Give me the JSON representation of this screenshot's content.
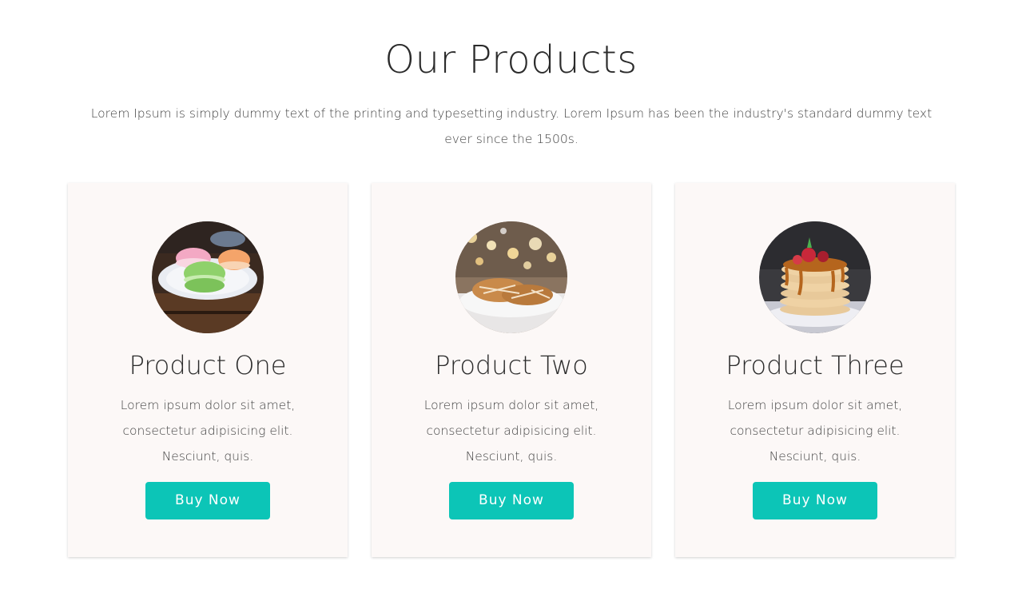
{
  "header": {
    "title": "Our Products",
    "description": "Lorem Ipsum is simply dummy text of the printing and typesetting industry. Lorem Ipsum has been the industry's standard dummy text ever since the 1500s."
  },
  "products": [
    {
      "name": "Product One",
      "description": "Lorem ipsum dolor sit amet, consectetur adipisicing elit. Nesciunt, quis.",
      "button_label": "Buy Now",
      "image": "macarons-photo"
    },
    {
      "name": "Product Two",
      "description": "Lorem ipsum dolor sit amet, consectetur adipisicing elit. Nesciunt, quis.",
      "button_label": "Buy Now",
      "image": "cookies-photo"
    },
    {
      "name": "Product Three",
      "description": "Lorem ipsum dolor sit amet, consectetur adipisicing elit. Nesciunt, quis.",
      "button_label": "Buy Now",
      "image": "pancakes-photo"
    }
  ],
  "colors": {
    "accent": "#0cc5b7",
    "card_background": "#fcf8f7",
    "heading": "#2b2b2b"
  }
}
